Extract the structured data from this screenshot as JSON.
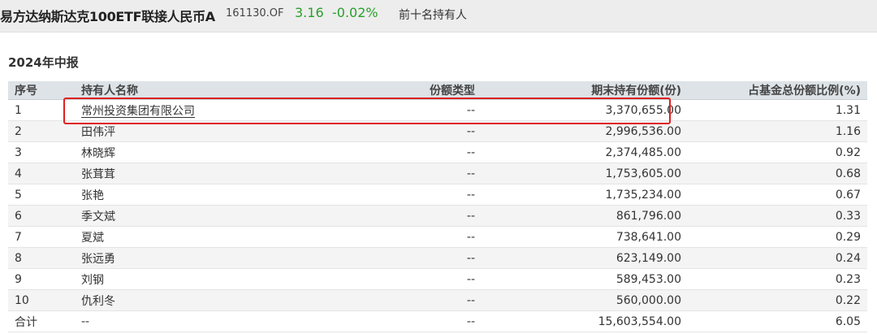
{
  "header": {
    "fund_name": "易方达纳斯达克100ETF联接人民币A",
    "fund_code": "161130.OF",
    "price": "3.16",
    "change": "-0.02%",
    "page_tab": "前十名持有人",
    "change_color": "#27a02a"
  },
  "report": {
    "title": "2024年中报",
    "columns": {
      "index": "序号",
      "holder": "持有人名称",
      "share_type": "份额类型",
      "shares": "期末持有份额(份)",
      "ratio": "占基金总份额比例(%)"
    },
    "rows": [
      {
        "index": "1",
        "holder": "常州投资集团有限公司",
        "share_type": "--",
        "shares": "3,370,655.00",
        "ratio": "1.31"
      },
      {
        "index": "2",
        "holder": "田伟泙",
        "share_type": "--",
        "shares": "2,996,536.00",
        "ratio": "1.16"
      },
      {
        "index": "3",
        "holder": "林晓辉",
        "share_type": "--",
        "shares": "2,374,485.00",
        "ratio": "0.92"
      },
      {
        "index": "4",
        "holder": "张茸茸",
        "share_type": "--",
        "shares": "1,753,605.00",
        "ratio": "0.68"
      },
      {
        "index": "5",
        "holder": "张艳",
        "share_type": "--",
        "shares": "1,735,234.00",
        "ratio": "0.67"
      },
      {
        "index": "6",
        "holder": "季文斌",
        "share_type": "--",
        "shares": "861,796.00",
        "ratio": "0.33"
      },
      {
        "index": "7",
        "holder": "夏斌",
        "share_type": "--",
        "shares": "738,641.00",
        "ratio": "0.29"
      },
      {
        "index": "8",
        "holder": "张远勇",
        "share_type": "--",
        "shares": "623,149.00",
        "ratio": "0.24"
      },
      {
        "index": "9",
        "holder": "刘钢",
        "share_type": "--",
        "shares": "589,453.00",
        "ratio": "0.23"
      },
      {
        "index": "10",
        "holder": "仇利冬",
        "share_type": "--",
        "shares": "560,000.00",
        "ratio": "0.22"
      }
    ],
    "total": {
      "index": "合计",
      "holder": "--",
      "share_type": "--",
      "shares": "15,603,554.00",
      "ratio": "6.05"
    },
    "highlight_color": "#e02020"
  }
}
